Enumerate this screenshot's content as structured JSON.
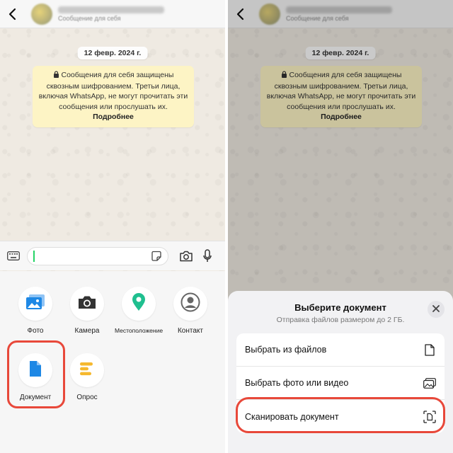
{
  "left": {
    "chat": {
      "header_subtitle": "Сообщение для себя",
      "date": "12 февр. 2024 г.",
      "notice_text": "Сообщения для себя защищены сквозным шифрованием. Третьи лица, включая WhatsApp, не могут прочитать эти сообщения или прослушать их.",
      "notice_more": "Подробнее"
    },
    "attachments": [
      {
        "label": "Фото",
        "icon": "gallery-icon",
        "color": "#1e88e5"
      },
      {
        "label": "Камера",
        "icon": "camera-icon",
        "color": "#333333"
      },
      {
        "label": "Местоположение",
        "icon": "location-pin-icon",
        "color": "#1fbf8f"
      },
      {
        "label": "Контакт",
        "icon": "contact-icon",
        "color": "#666666"
      },
      {
        "label": "Документ",
        "icon": "document-icon",
        "color": "#1e88e5"
      },
      {
        "label": "Опрос",
        "icon": "poll-icon",
        "color": "#f5b82e"
      }
    ]
  },
  "right": {
    "chat": {
      "header_subtitle": "Сообщение для себя",
      "date": "12 февр. 2024 г.",
      "notice_text": "Сообщения для себя защищены сквозным шифрованием. Третьи лица, включая WhatsApp, не могут прочитать эти сообщения или прослушать их.",
      "notice_more": "Подробнее"
    },
    "sheet": {
      "title": "Выберите документ",
      "subtitle": "Отправка файлов размером до 2 ГБ.",
      "options": [
        {
          "label": "Выбрать из файлов",
          "icon": "file-icon"
        },
        {
          "label": "Выбрать фото или видео",
          "icon": "photo-icon"
        },
        {
          "label": "Сканировать документ",
          "icon": "scan-document-icon"
        }
      ]
    }
  },
  "colors": {
    "highlight": "#e8483a",
    "notice_bg": "#fdf4c5",
    "wallpaper": "#efeae2"
  }
}
